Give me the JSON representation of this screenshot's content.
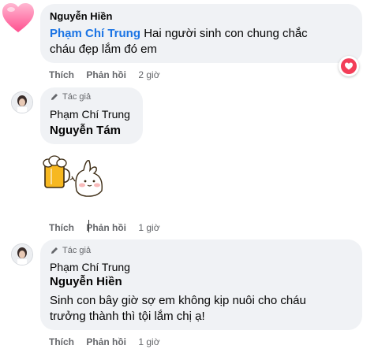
{
  "comment1": {
    "author": "Nguyễn Hiền",
    "tagged": "Phạm Chí Trung",
    "body_line1": "Hai người sinh con chung chắc",
    "body_line2": "cháu đẹp lắm đó em",
    "like": "Thích",
    "reply": "Phản hồi",
    "time": "2 giờ",
    "reaction": "love-icon"
  },
  "comment2": {
    "badge": "Tác giả",
    "author": "Phạm Chí Trung",
    "tagged": "Nguyễn Tám",
    "sticker": "beer-bunny-sticker",
    "like": "Thích",
    "reply": "Phản hồi",
    "time": "1 giờ"
  },
  "comment3": {
    "badge": "Tác giả",
    "author": "Phạm Chí Trung",
    "tagged": "Nguyễn Hiền",
    "body_line1": "Sinh con bây giờ sợ em không kịp nuôi cho cháu",
    "body_line2": "trưởng thành thì tội lắm chị ạ!",
    "like": "Thích",
    "reply": "Phản hồi",
    "time": "1 giờ"
  },
  "colors": {
    "tag": "#1b74e4",
    "bubble": "#f0f2f5",
    "meta": "#65676b",
    "love": "#f33e58",
    "heart_avatar": "#ff6fa6"
  }
}
